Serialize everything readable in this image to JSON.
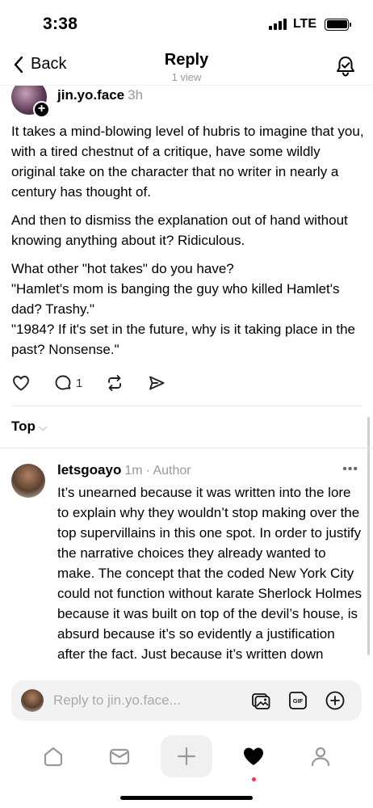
{
  "status": {
    "time": "3:38",
    "network": "LTE"
  },
  "header": {
    "back_label": "Back",
    "title": "Reply",
    "subtitle": "1 view"
  },
  "post": {
    "username": "jin.yo.face",
    "time": "3h",
    "paragraphs": [
      "It takes a mind-blowing level of hubris to imagine that you, with a tired chestnut of a critique, have some wildly original take on the character that no writer in nearly a century has thought of.",
      "And then to dismiss the explanation out of hand without knowing anything about it? Ridiculous.",
      "What other \"hot takes\" do you have?",
      "\"Hamlet's mom is banging the guy who killed Hamlet's dad? Trashy.\"",
      "\"1984? If it's set in the future, why is it taking place in the past? Nonsense.\""
    ],
    "reply_count": "1"
  },
  "sort": {
    "label": "Top"
  },
  "comment": {
    "username": "letsgoayo",
    "time": "1m",
    "badge": "· Author",
    "more": "•••",
    "text": "It’s unearned because it was written into the lore to explain why they wouldn’t stop making over the top supervillains in this one spot. In order to justify the narrative choices they already wanted to make. The concept that the coded New York City could not function without karate Sherlock Holmes because it was built on top of the devil’s house, is absurd because it’s so evidently a justification after the fact. Just because it’s written down"
  },
  "reply_bar": {
    "placeholder": "Reply to jin.yo.face..."
  },
  "icons": {
    "back": "chevron-left-icon",
    "bell": "bell-check-icon",
    "like": "heart-icon",
    "comment": "comment-bubble-icon",
    "repost": "repost-icon",
    "share": "send-icon",
    "image": "image-icon",
    "gif": "gif-icon",
    "add": "plus-circle-icon",
    "home": "home-icon",
    "inbox": "inbox-icon",
    "compose": "plus-icon",
    "activity": "heart-filled-icon",
    "profile": "person-icon"
  },
  "colors": {
    "notification_dot": "#ff3040",
    "muted_text": "#999999",
    "compose_bg": "#f0f0f0"
  }
}
